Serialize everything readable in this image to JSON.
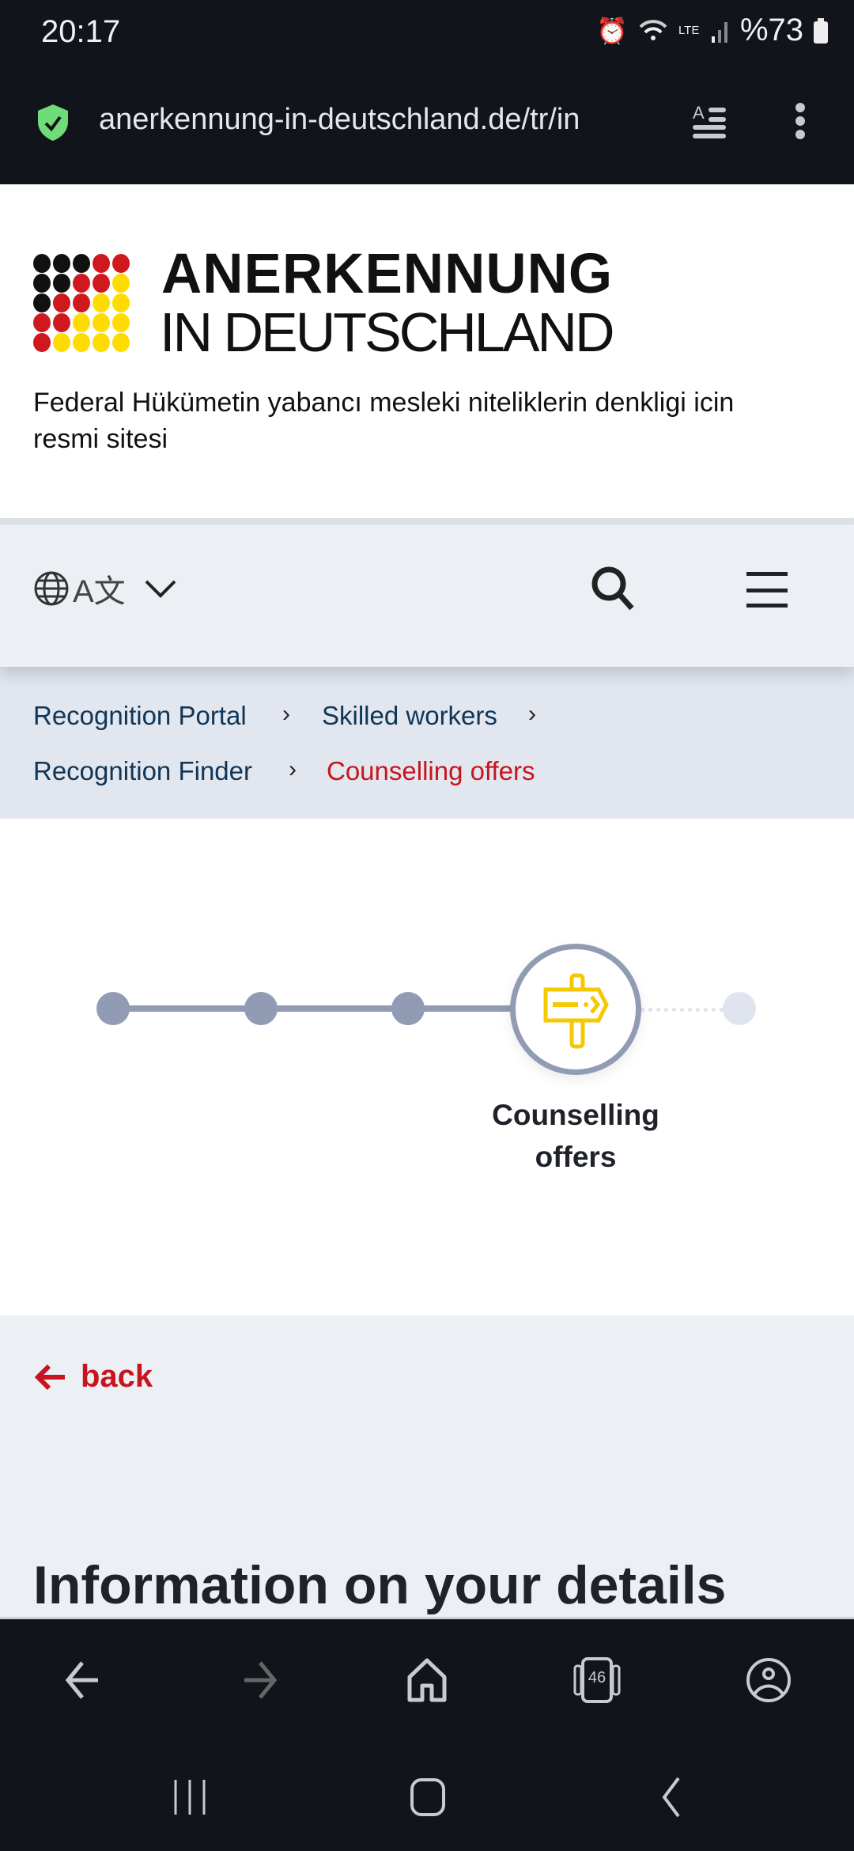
{
  "status_bar": {
    "time": "20:17",
    "battery": "%73",
    "network": "LTE"
  },
  "browser": {
    "url": "anerkennung-in-deutschland.de/tr/in",
    "tab_count": "46"
  },
  "header": {
    "logo_line1": "ANERKENNUNG",
    "logo_line2": "IN DEUTSCHLAND",
    "tagline": "Federal Hükümetin yabancı mesleki niteliklerin denkligi icin resmi sitesi",
    "logo_colors": {
      "black": "#111111",
      "red": "#d0191e",
      "gold": "#ffdc00"
    }
  },
  "navbar": {
    "language_label": "A文"
  },
  "breadcrumb": {
    "items": [
      "Recognition Portal",
      "Skilled workers",
      "Recognition Finder"
    ],
    "current": "Counselling offers"
  },
  "stepper": {
    "total_steps": 5,
    "current_step": 4,
    "current_label": "Counselling offers"
  },
  "content": {
    "back_label": "back",
    "heading": "Information on your details"
  },
  "colors": {
    "accent_red": "#c8141e",
    "link_blue": "#0f3557",
    "step_gray": "#919bb3",
    "icon_yellow": "#f5c800"
  }
}
